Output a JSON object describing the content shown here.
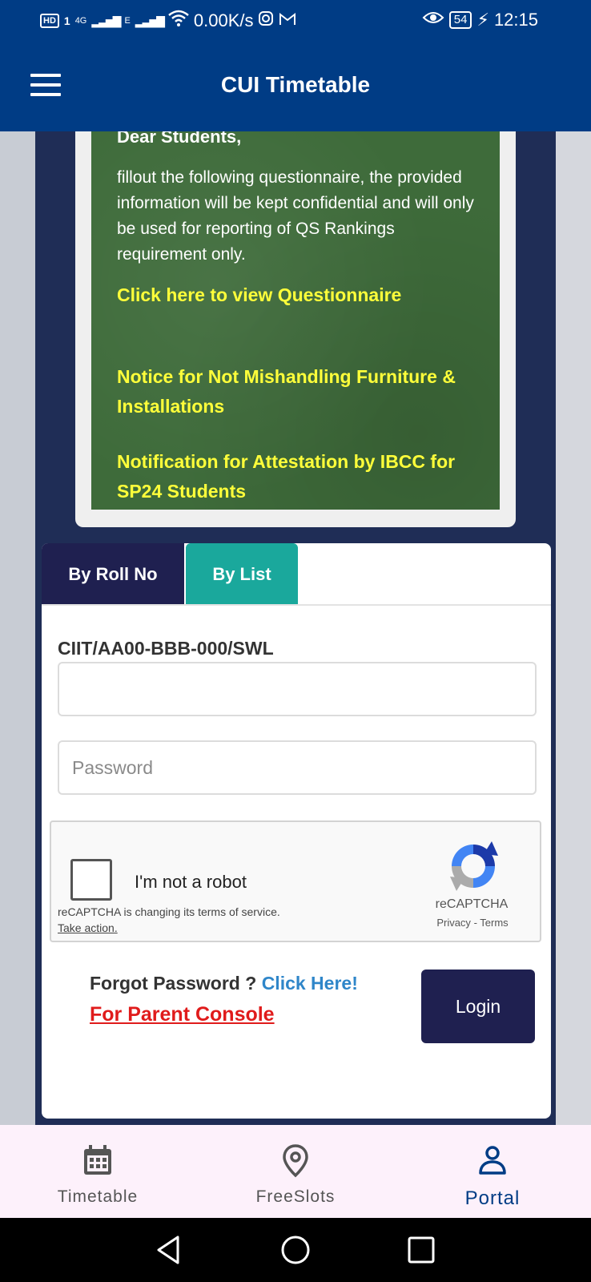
{
  "status_bar": {
    "hd_label": "HD",
    "sim1": "1",
    "net_4g": "4G",
    "net_e": "E",
    "speed": "0.00K/s",
    "battery": "54",
    "time": "12:15"
  },
  "appbar": {
    "title": "CUI Timetable"
  },
  "notice": {
    "greeting": "Dear Students,",
    "body": "fillout the following questionnaire, the provided information will be kept confidential and will only be used for reporting of QS Rankings requirement only.",
    "links": [
      "Click here to view Questionnaire",
      "Notice for Not Mishandling Furniture & Installations",
      "Notification for Attestation by IBCC for SP24 Students"
    ]
  },
  "login": {
    "tabs": [
      "By Roll No",
      "By List"
    ],
    "roll_label": "CIIT/AA00-BBB-000/SWL",
    "roll_value": "",
    "password_placeholder": "Password",
    "recaptcha": {
      "label": "I'm not a robot",
      "changing": "reCAPTCHA is changing its terms of service.",
      "take_action": "Take action.",
      "brand": "reCAPTCHA",
      "privacy": "Privacy",
      "terms": "Terms",
      "separator": "-"
    },
    "forgot_text": "Forgot Password ?",
    "forgot_link": "Click Here!",
    "parent_link": "For Parent Console",
    "login_button": "Login"
  },
  "bottom_nav": [
    {
      "label": "Timetable",
      "icon": "calendar-icon",
      "active": false
    },
    {
      "label": "FreeSlots",
      "icon": "location-pin-icon",
      "active": false
    },
    {
      "label": "Portal",
      "icon": "person-icon",
      "active": true
    }
  ],
  "colors": {
    "primary": "#003c85",
    "tab_dark": "#1f2050",
    "tab_teal": "#1aa89c",
    "chalk_yellow": "#ffff3a",
    "link_red": "#e01b1b"
  }
}
